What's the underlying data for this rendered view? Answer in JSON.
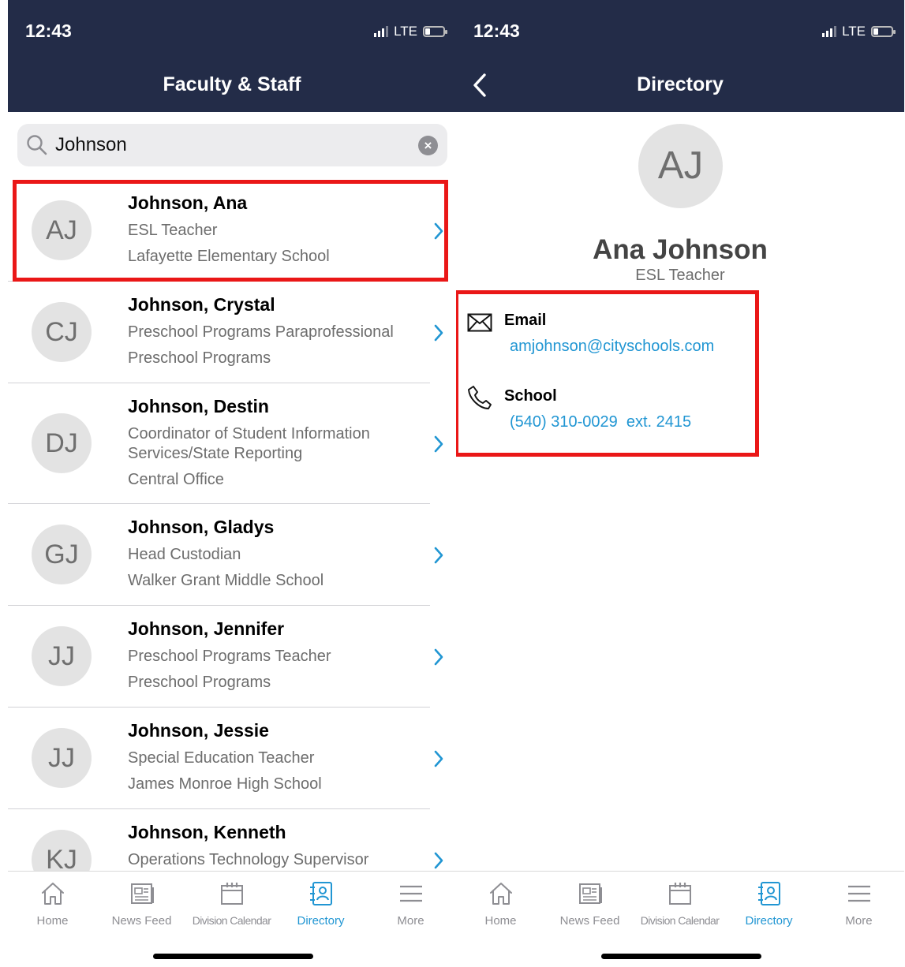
{
  "status_bar": {
    "time": "12:43",
    "network": "LTE"
  },
  "left": {
    "nav_title": "Faculty & Staff",
    "search": {
      "value": "Johnson",
      "placeholder": "Search"
    },
    "results": [
      {
        "initials": "AJ",
        "name": "Johnson, Ana",
        "title": "ESL Teacher",
        "school": "Lafayette Elementary School"
      },
      {
        "initials": "CJ",
        "name": "Johnson, Crystal",
        "title": "Preschool Programs Paraprofessional",
        "school": "Preschool Programs"
      },
      {
        "initials": "DJ",
        "name": "Johnson, Destin",
        "title": "Coordinator of Student Information Services/State Reporting",
        "school": "Central Office"
      },
      {
        "initials": "GJ",
        "name": "Johnson, Gladys",
        "title": "Head Custodian",
        "school": "Walker Grant Middle School"
      },
      {
        "initials": "JJ",
        "name": "Johnson, Jennifer",
        "title": "Preschool Programs Teacher",
        "school": "Preschool Programs"
      },
      {
        "initials": "JJ",
        "name": "Johnson, Jessie",
        "title": "Special Education Teacher",
        "school": "James Monroe High School"
      },
      {
        "initials": "KJ",
        "name": "Johnson, Kenneth",
        "title": "Operations Technology Supervisor",
        "school": ""
      }
    ]
  },
  "right": {
    "nav_title": "Directory",
    "profile": {
      "initials": "AJ",
      "name": "Ana Johnson",
      "role": "ESL Teacher",
      "email_label": "Email",
      "email": "amjohnson@cityschools.com",
      "phone_label": "School",
      "phone": "(540) 310-0029  ext. 2415"
    }
  },
  "tabs": [
    {
      "label": "Home",
      "icon": "home-icon"
    },
    {
      "label": "News Feed",
      "icon": "newspaper-icon"
    },
    {
      "label": "Division Calendar",
      "icon": "calendar-icon"
    },
    {
      "label": "Directory",
      "icon": "contact-book-icon",
      "active": true
    },
    {
      "label": "More",
      "icon": "menu-icon"
    }
  ],
  "colors": {
    "nav_bg": "#232c48",
    "accent": "#2196d3",
    "highlight": "#ea1717"
  }
}
